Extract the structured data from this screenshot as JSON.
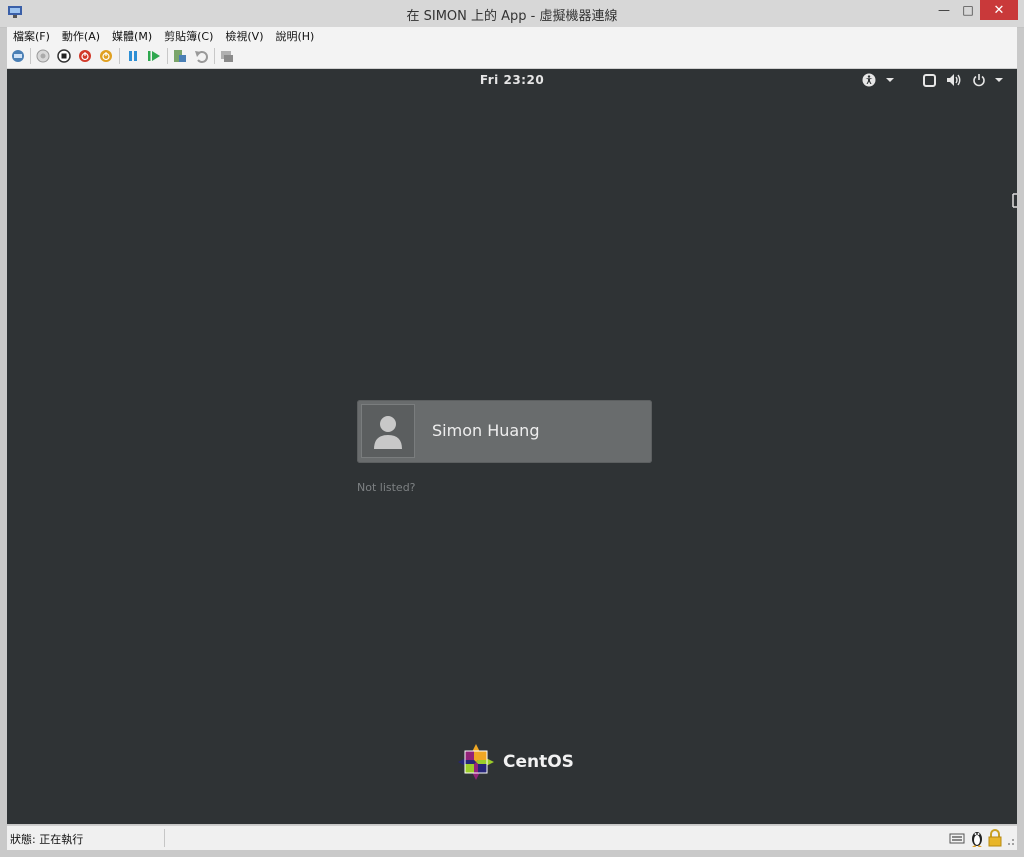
{
  "window": {
    "title": "在 SIMON 上的 App - 虛擬機器連線",
    "minimize_icon": "minimize-icon",
    "maximize_icon": "maximize-icon",
    "close_icon": "close-icon",
    "close_color": "#c9393a"
  },
  "menu": {
    "items": [
      {
        "label": "檔案(F)"
      },
      {
        "label": "動作(A)"
      },
      {
        "label": "媒體(M)"
      },
      {
        "label": "剪貼簿(C)"
      },
      {
        "label": "檢視(V)"
      },
      {
        "label": "說明(H)"
      }
    ]
  },
  "toolbar": {
    "icons": [
      "ctrl-alt-del-icon",
      "start-icon",
      "turn-off-icon",
      "shutdown-icon",
      "save-icon",
      "pause-icon",
      "reset-icon",
      "checkpoint-icon",
      "revert-icon",
      "enhanced-session-icon"
    ]
  },
  "vm": {
    "top_bar": {
      "clock": "Fri 23:20"
    },
    "tray": [
      "accessibility-icon",
      "window-icon",
      "volume-icon",
      "power-icon"
    ],
    "login": {
      "user_name": "Simon Huang",
      "not_listed": "Not listed?"
    },
    "brand": {
      "name": "CentOS"
    },
    "background_color": "#2f3335"
  },
  "status_bar": {
    "status": "狀態: 正在執行"
  }
}
